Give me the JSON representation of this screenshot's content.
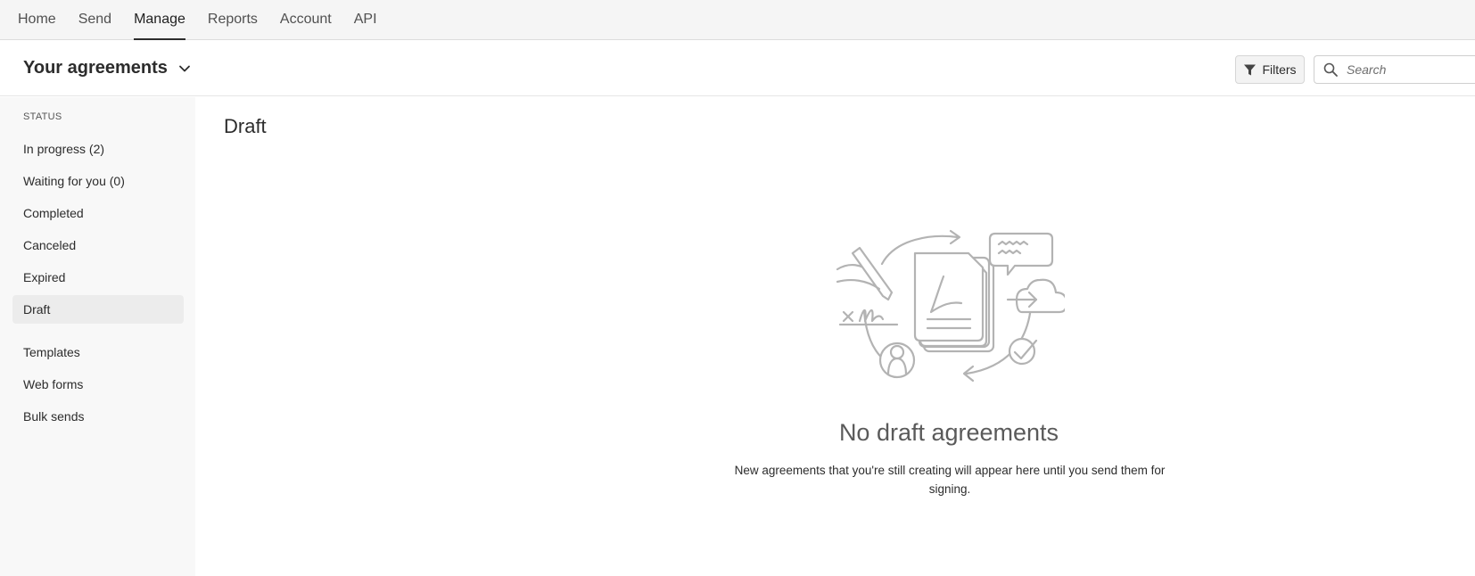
{
  "topnav": {
    "items": [
      {
        "label": "Home"
      },
      {
        "label": "Send"
      },
      {
        "label": "Manage"
      },
      {
        "label": "Reports"
      },
      {
        "label": "Account"
      },
      {
        "label": "API"
      }
    ],
    "active": "Manage"
  },
  "header": {
    "title": "Your agreements",
    "filters_label": "Filters",
    "search_placeholder": "Search"
  },
  "sidebar": {
    "section_label": "STATUS",
    "status_items": [
      {
        "label": "In progress (2)"
      },
      {
        "label": "Waiting for you (0)"
      },
      {
        "label": "Completed"
      },
      {
        "label": "Canceled"
      },
      {
        "label": "Expired"
      },
      {
        "label": "Draft"
      }
    ],
    "selected": "Draft",
    "other_items": [
      {
        "label": "Templates"
      },
      {
        "label": "Web forms"
      },
      {
        "label": "Bulk sends"
      }
    ]
  },
  "main": {
    "page_title": "Draft",
    "empty_heading": "No draft agreements",
    "empty_description": "New agreements that you're still creating will appear here until you send them for signing."
  },
  "colors": {
    "nav_bg": "#f5f5f5",
    "sidebar_bg": "#f8f8f8",
    "selected_bg": "#ececec",
    "illustration_stroke": "#b3b3b3"
  },
  "icons": [
    "chevron-down-icon",
    "filter-icon",
    "search-icon",
    "empty-state-illustration"
  ]
}
